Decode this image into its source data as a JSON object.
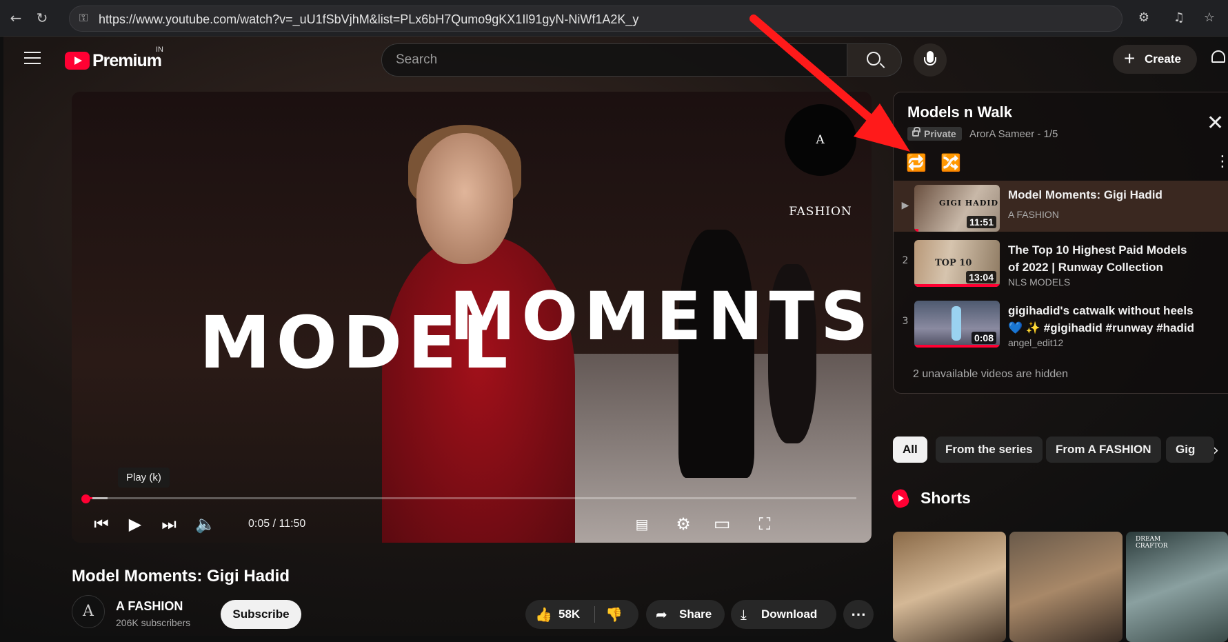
{
  "browser": {
    "url": "https://www.youtube.com/watch?v=_uU1fSbVjhM&list=PLx6bH7Qumo9gKX1Il91gyN-NiWf1A2K_y"
  },
  "masthead": {
    "logo_text": "Premium",
    "country": "IN",
    "search_placeholder": "Search",
    "create_label": "Create"
  },
  "player": {
    "overlay_word1": "MODEL",
    "overlay_word2": "MOMENTS",
    "channel_badge": "A FASHION",
    "tooltip": "Play (k)",
    "time": "0:05 / 11:50",
    "progress_fraction": 0.007
  },
  "video": {
    "title": "Model Moments: Gigi Hadid",
    "channel": "A FASHION",
    "subscribers": "206K subscribers",
    "avatar_letter": "A",
    "subscribe_label": "Subscribe",
    "likes": "58K",
    "share_label": "Share",
    "download_label": "Download",
    "more_label": "⋯"
  },
  "playlist": {
    "title": "Models n Walk",
    "privacy": "Private",
    "owner_position": "ArorA Sameer - 1/5",
    "items": [
      {
        "index": "▶",
        "title": "Model Moments: Gigi Hadid",
        "channel": "A FASHION",
        "duration": "11:51",
        "thumb_text": "GIGI HADID",
        "watched": 0.05
      },
      {
        "index": "2",
        "title": "The Top 10 Highest Paid Models of 2022 | Runway Collection",
        "channel": "NLS MODELS",
        "duration": "13:04",
        "thumb_text": "TOP 10",
        "watched": 1
      },
      {
        "index": "3",
        "title": "gigihadid's catwalk without heels 💙 ✨ #gigihadid #runway #hadid",
        "channel": "angel_edit12",
        "duration": "0:08",
        "thumb_text": "",
        "watched": 1
      }
    ],
    "hidden_note": "2 unavailable videos are hidden"
  },
  "chips": [
    "All",
    "From the series",
    "From A FASHION",
    "Gig"
  ],
  "shorts": {
    "title": "Shorts",
    "thumb3_text": "DREAM CRAFTOR"
  },
  "colors": {
    "accent": "#ff0033",
    "annotation_arrow": "#ff1a1a"
  }
}
